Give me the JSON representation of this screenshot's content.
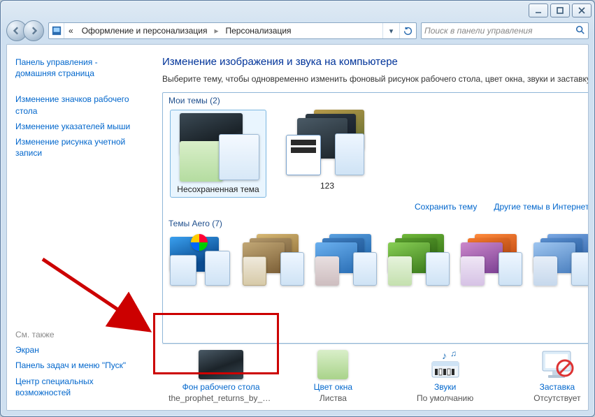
{
  "breadcrumbs": {
    "back_chevrons": "«",
    "level1": "Оформление и персонализация",
    "level2": "Персонализация"
  },
  "search": {
    "placeholder": "Поиск в панели управления"
  },
  "sidebar": {
    "home1": "Панель управления -",
    "home2": "домашняя страница",
    "links": [
      "Изменение значков рабочего стола",
      "Изменение указателей мыши",
      "Изменение рисунка учетной записи"
    ],
    "see_also_label": "См. также",
    "see_also": [
      "Экран",
      "Панель задач и меню \"Пуск\"",
      "Центр специальных возможностей"
    ]
  },
  "main": {
    "title": "Изменение изображения и звука на компьютере",
    "subtitle": "Выберите тему, чтобы одновременно изменить фоновый рисунок рабочего стола, цвет окна, звуки и заставку.",
    "groups": {
      "my_label": "Мои темы (2)",
      "aero_label": "Темы Aero (7)"
    },
    "themes": [
      {
        "name": "Несохраненная тема"
      },
      {
        "name": "123"
      }
    ],
    "links": {
      "save": "Сохранить тему",
      "more": "Другие темы в Интернете"
    }
  },
  "tasks": {
    "bg": {
      "label": "Фон рабочего стола",
      "value": "the_prophet_returns_by_m..."
    },
    "color": {
      "label": "Цвет окна",
      "value": "Листва"
    },
    "sounds": {
      "label": "Звуки",
      "value": "По умолчанию"
    },
    "saver": {
      "label": "Заставка",
      "value": "Отсутствует"
    }
  }
}
